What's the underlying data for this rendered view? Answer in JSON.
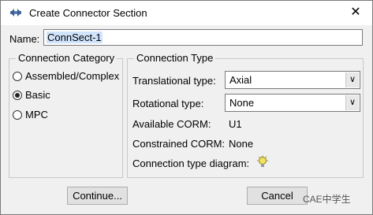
{
  "window": {
    "title": "Create Connector Section",
    "close_label": "✕"
  },
  "name": {
    "label": "Name:",
    "value": "ConnSect-1"
  },
  "category": {
    "title": "Connection Category",
    "options": [
      {
        "label": "Assembled/Complex",
        "selected": false
      },
      {
        "label": "Basic",
        "selected": true
      },
      {
        "label": "MPC",
        "selected": false
      }
    ]
  },
  "type": {
    "title": "Connection Type",
    "translational_label": "Translational type:",
    "translational_value": "Axial",
    "rotational_label": "Rotational type:",
    "rotational_value": "None",
    "available_label": "Available CORM:",
    "available_value": "U1",
    "constrained_label": "Constrained CORM:",
    "constrained_value": "None",
    "diagram_label": "Connection type diagram:"
  },
  "buttons": {
    "continue_label": "Continue...",
    "cancel_label": "Cancel"
  },
  "watermark": {
    "text": "CAE中学生"
  }
}
